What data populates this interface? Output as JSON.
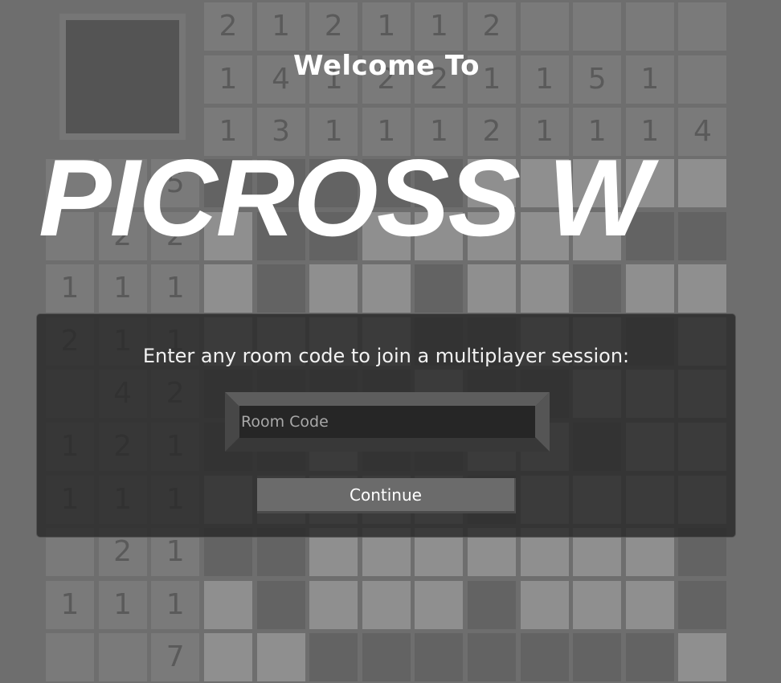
{
  "title": {
    "welcome": "Welcome To",
    "logo": "PICROSS W"
  },
  "dialog": {
    "prompt": "Enter any room code to join a multiplayer session:",
    "room_code_placeholder": "Room Code",
    "room_code_value": "",
    "continue_label": "Continue"
  },
  "board": {
    "column_clues": [
      [
        "2",
        "1",
        "1"
      ],
      [
        "1",
        "4",
        "3"
      ],
      [
        "2",
        "1",
        "1"
      ],
      [
        "1",
        "2",
        "1"
      ],
      [
        "1",
        "2",
        "1"
      ],
      [
        "2",
        "1",
        "2"
      ],
      [
        "",
        "1",
        "1"
      ],
      [
        "",
        "5",
        "1"
      ],
      [
        "",
        "1",
        "1"
      ],
      [
        "",
        "",
        "4"
      ]
    ],
    "row_clues": [
      [
        "",
        "",
        "5"
      ],
      [
        "",
        "2",
        "2"
      ],
      [
        "1",
        "1",
        "1"
      ],
      [
        "2",
        "1",
        "1"
      ],
      [
        "",
        "4",
        "2"
      ],
      [
        "1",
        "2",
        "1"
      ],
      [
        "1",
        "1",
        "1"
      ],
      [
        "",
        "2",
        "1"
      ],
      [
        "1",
        "1",
        "1"
      ],
      [
        "",
        "",
        "7"
      ]
    ],
    "filled_cells": [
      [
        1,
        1,
        1,
        1,
        1,
        0,
        0,
        0,
        0,
        0
      ],
      [
        0,
        1,
        1,
        0,
        0,
        0,
        0,
        0,
        1,
        1
      ],
      [
        0,
        1,
        0,
        0,
        1,
        0,
        0,
        1,
        0,
        0
      ],
      [
        0,
        0,
        0,
        0,
        1,
        1,
        0,
        0,
        1,
        0
      ],
      [
        1,
        1,
        1,
        1,
        0,
        1,
        1,
        0,
        0,
        0
      ],
      [
        1,
        1,
        0,
        1,
        1,
        0,
        0,
        1,
        0,
        0
      ],
      [
        0,
        0,
        0,
        0,
        0,
        1,
        0,
        0,
        0,
        0
      ],
      [
        1,
        1,
        0,
        0,
        0,
        0,
        0,
        0,
        0,
        1
      ],
      [
        0,
        1,
        0,
        0,
        0,
        1,
        0,
        0,
        0,
        1
      ],
      [
        0,
        0,
        1,
        1,
        1,
        1,
        1,
        1,
        1,
        0
      ]
    ]
  }
}
